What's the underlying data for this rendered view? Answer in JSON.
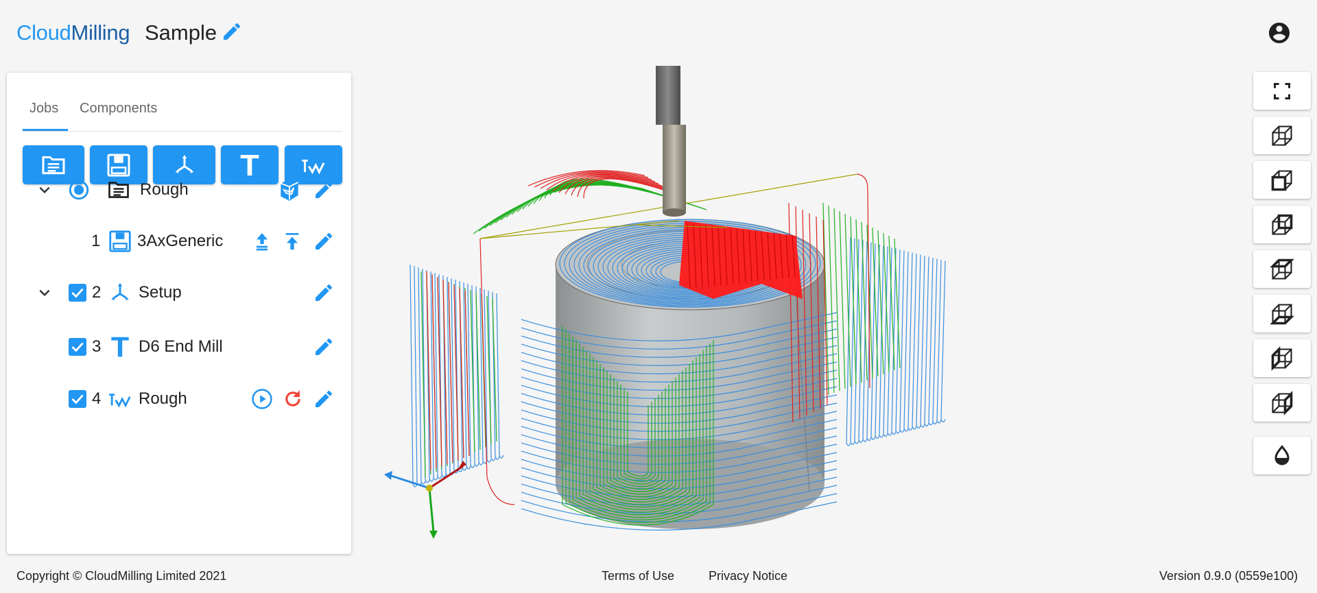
{
  "header": {
    "brand_part1": "Cloud",
    "brand_part2": "Milling",
    "project_name": "Sample"
  },
  "tabs": [
    {
      "label": "Jobs",
      "active": true
    },
    {
      "label": "Components",
      "active": false
    }
  ],
  "toolbar": {
    "buttons": [
      "folder-icon",
      "machine-icon",
      "setup-axes-icon",
      "tool-icon",
      "toolpath-icon"
    ]
  },
  "tree": {
    "job": {
      "label": "Rough"
    },
    "machine": {
      "number": "1",
      "label": "3AxGeneric"
    },
    "setup": {
      "number": "2",
      "label": "Setup"
    },
    "tool": {
      "number": "3",
      "label": "D6 End Mill"
    },
    "operation": {
      "number": "4",
      "label": "Rough"
    }
  },
  "view_tools": [
    "fullscreen-icon",
    "view-iso-icon",
    "view-front-icon",
    "view-back-icon",
    "view-top-icon",
    "view-bottom-icon",
    "view-left-icon",
    "view-right-icon",
    "render-mode-icon"
  ],
  "footer": {
    "copyright": "Copyright © CloudMilling Limited 2021",
    "terms": "Terms of Use",
    "privacy": "Privacy Notice",
    "version": "Version 0.9.0 (0559e100)"
  },
  "colors": {
    "accent": "#2196f3",
    "brand_dark": "#1a5fa8",
    "toolpath_blue": "#3a8fe0",
    "toolpath_green": "#22b022",
    "toolpath_red": "#e02020",
    "refresh_red": "#f44336"
  }
}
